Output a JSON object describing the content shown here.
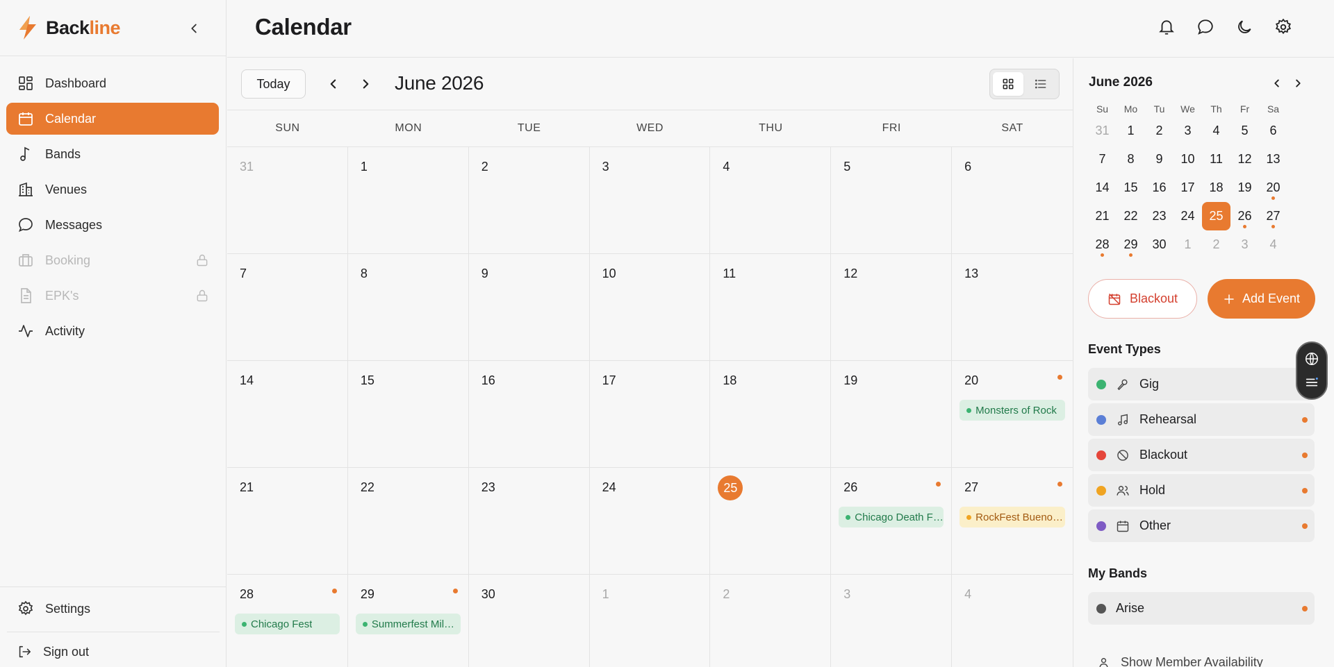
{
  "brand": {
    "name_main": "Back",
    "name_accent": "line"
  },
  "sidebar": {
    "items": [
      {
        "label": "Dashboard",
        "icon": "dashboard-icon"
      },
      {
        "label": "Calendar",
        "icon": "calendar-icon",
        "active": true
      },
      {
        "label": "Bands",
        "icon": "music-note-icon"
      },
      {
        "label": "Venues",
        "icon": "building-icon"
      },
      {
        "label": "Messages",
        "icon": "message-icon"
      },
      {
        "label": "Booking",
        "icon": "briefcase-icon",
        "locked": true
      },
      {
        "label": "EPK's",
        "icon": "document-icon",
        "locked": true
      },
      {
        "label": "Activity",
        "icon": "activity-icon"
      }
    ],
    "settings_label": "Settings",
    "signout_label": "Sign out"
  },
  "header": {
    "title": "Calendar"
  },
  "toolbar": {
    "today_label": "Today",
    "month_title": "June 2026"
  },
  "weekdays": [
    "SUN",
    "MON",
    "TUE",
    "WED",
    "THU",
    "FRI",
    "SAT"
  ],
  "month_grid": [
    {
      "day": "31",
      "other": true
    },
    {
      "day": "1"
    },
    {
      "day": "2"
    },
    {
      "day": "3"
    },
    {
      "day": "4"
    },
    {
      "day": "5"
    },
    {
      "day": "6"
    },
    {
      "day": "7"
    },
    {
      "day": "8"
    },
    {
      "day": "9"
    },
    {
      "day": "10"
    },
    {
      "day": "11"
    },
    {
      "day": "12"
    },
    {
      "day": "13"
    },
    {
      "day": "14"
    },
    {
      "day": "15"
    },
    {
      "day": "16"
    },
    {
      "day": "17"
    },
    {
      "day": "18"
    },
    {
      "day": "19"
    },
    {
      "day": "20",
      "dot": true,
      "event": "Monsters of Rock",
      "color": "green"
    },
    {
      "day": "21"
    },
    {
      "day": "22"
    },
    {
      "day": "23"
    },
    {
      "day": "24"
    },
    {
      "day": "25",
      "today": true
    },
    {
      "day": "26",
      "dot": true,
      "event": "Chicago Death Fest",
      "color": "green"
    },
    {
      "day": "27",
      "dot": true,
      "event": "RockFest Buenos Aires",
      "color": "yellow"
    },
    {
      "day": "28",
      "dot": true,
      "event": "Chicago Fest",
      "color": "green"
    },
    {
      "day": "29",
      "dot": true,
      "event": "Summerfest Milwaukee",
      "color": "green"
    },
    {
      "day": "30"
    },
    {
      "day": "1",
      "other": true
    },
    {
      "day": "2",
      "other": true
    },
    {
      "day": "3",
      "other": true
    },
    {
      "day": "4",
      "other": true
    }
  ],
  "mini_calendar": {
    "title": "June 2026",
    "weekdays": [
      "Su",
      "Mo",
      "Tu",
      "We",
      "Th",
      "Fr",
      "Sa"
    ],
    "days": [
      {
        "d": "31",
        "other": true
      },
      {
        "d": "1"
      },
      {
        "d": "2"
      },
      {
        "d": "3"
      },
      {
        "d": "4"
      },
      {
        "d": "5"
      },
      {
        "d": "6"
      },
      {
        "d": "7"
      },
      {
        "d": "8"
      },
      {
        "d": "9"
      },
      {
        "d": "10"
      },
      {
        "d": "11"
      },
      {
        "d": "12"
      },
      {
        "d": "13"
      },
      {
        "d": "14"
      },
      {
        "d": "15"
      },
      {
        "d": "16"
      },
      {
        "d": "17"
      },
      {
        "d": "18"
      },
      {
        "d": "19"
      },
      {
        "d": "20",
        "dot": true
      },
      {
        "d": "21"
      },
      {
        "d": "22"
      },
      {
        "d": "23"
      },
      {
        "d": "24"
      },
      {
        "d": "25",
        "selected": true
      },
      {
        "d": "26",
        "dot": true
      },
      {
        "d": "27",
        "dot": true
      },
      {
        "d": "28",
        "dot": true
      },
      {
        "d": "29",
        "dot": true
      },
      {
        "d": "30"
      },
      {
        "d": "1",
        "other": true
      },
      {
        "d": "2",
        "other": true
      },
      {
        "d": "3",
        "other": true
      },
      {
        "d": "4",
        "other": true
      }
    ]
  },
  "actions": {
    "blackout_label": "Blackout",
    "add_event_label": "Add Event"
  },
  "event_types": {
    "title": "Event Types",
    "items": [
      {
        "label": "Gig",
        "color": "#3cb371",
        "icon": "microphone-icon"
      },
      {
        "label": "Rehearsal",
        "color": "#5b7fd6",
        "icon": "music-note-icon"
      },
      {
        "label": "Blackout",
        "color": "#e5453a",
        "icon": "ban-icon"
      },
      {
        "label": "Hold",
        "color": "#f0a422",
        "icon": "users-icon"
      },
      {
        "label": "Other",
        "color": "#7e5bc4",
        "icon": "calendar-icon"
      }
    ]
  },
  "my_bands": {
    "title": "My Bands",
    "items": [
      {
        "label": "Arise",
        "color": "#555555"
      }
    ]
  },
  "show_availability_label": "Show Member Availability",
  "colors": {
    "accent": "#e87a30",
    "gig_green": "#3cb371",
    "hold_yellow": "#f0a422"
  }
}
